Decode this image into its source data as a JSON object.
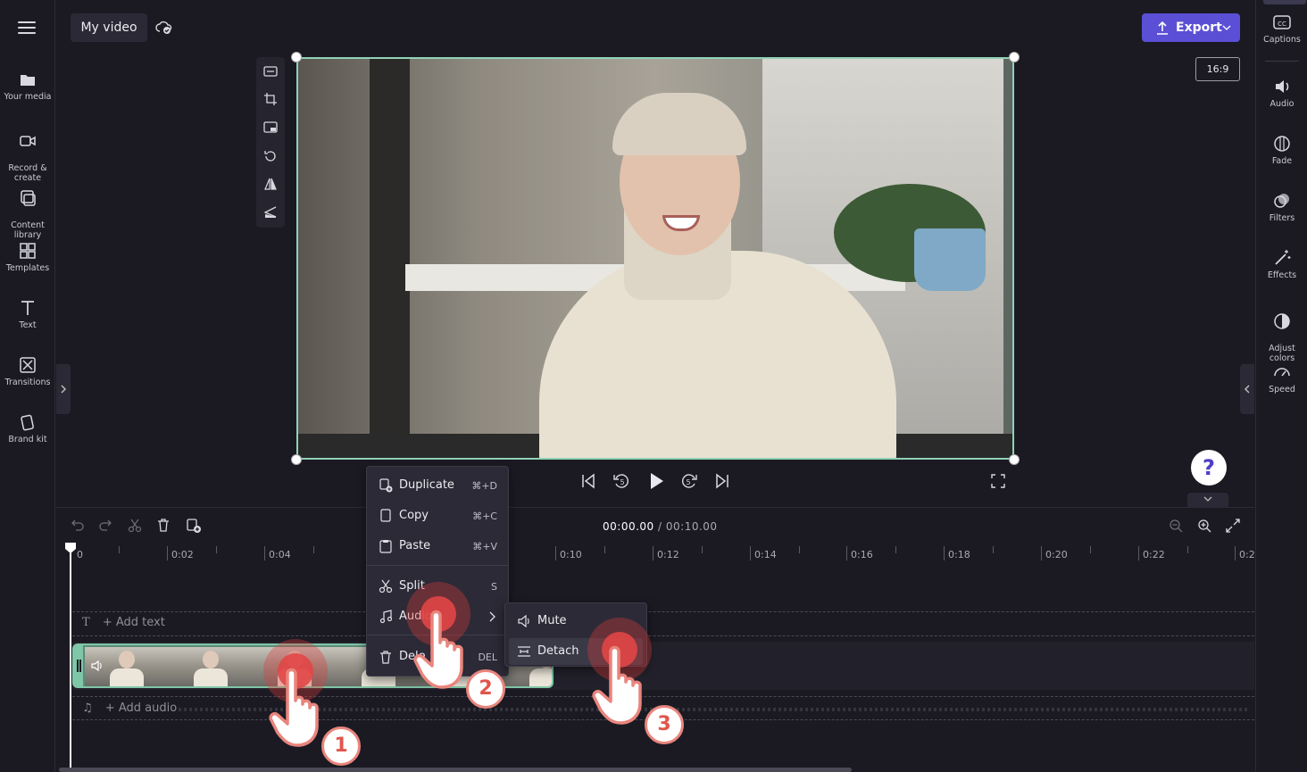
{
  "header": {
    "project_title": "My video",
    "export_label": "Export",
    "aspect_ratio": "16:9"
  },
  "left_nav": [
    {
      "label": "Your media",
      "icon": "folder-icon"
    },
    {
      "label": "Record &\ncreate",
      "icon": "camera-icon"
    },
    {
      "label": "Content\nlibrary",
      "icon": "library-icon"
    },
    {
      "label": "Templates",
      "icon": "templates-icon"
    },
    {
      "label": "Text",
      "icon": "text-icon"
    },
    {
      "label": "Transitions",
      "icon": "transitions-icon"
    },
    {
      "label": "Brand kit",
      "icon": "brand-kit-icon"
    }
  ],
  "right_nav": [
    {
      "label": "Captions",
      "icon": "captions-icon"
    },
    {
      "label": "Audio",
      "icon": "speaker-icon"
    },
    {
      "label": "Fade",
      "icon": "fade-icon"
    },
    {
      "label": "Filters",
      "icon": "filters-icon"
    },
    {
      "label": "Effects",
      "icon": "magic-wand-icon"
    },
    {
      "label": "Adjust\ncolors",
      "icon": "adjust-colors-icon"
    },
    {
      "label": "Speed",
      "icon": "speedometer-icon"
    }
  ],
  "timeline": {
    "current_time": "00:00.00",
    "separator": "/",
    "total_time": "00:10.00",
    "ruler": [
      "0",
      "0:02",
      "0:04",
      "0:10",
      "0:12",
      "0:14",
      "0:16",
      "0:18",
      "0:20",
      "0:22",
      "0:2"
    ],
    "add_text": "+ Add text",
    "add_audio": "+ Add audio"
  },
  "context_menu": {
    "items": [
      {
        "label": "Duplicate",
        "shortcut": "⌘+D"
      },
      {
        "label": "Copy",
        "shortcut": "⌘+C"
      },
      {
        "label": "Paste",
        "shortcut": "⌘+V"
      },
      {
        "label": "Split",
        "shortcut": "S"
      },
      {
        "label": "Audio",
        "shortcut": ""
      },
      {
        "label": "Dele",
        "shortcut": "DEL"
      }
    ],
    "submenu": [
      {
        "label": "Mute"
      },
      {
        "label": "Detach"
      }
    ]
  },
  "steps": [
    "1",
    "2",
    "3"
  ],
  "help_label": "?",
  "colors": {
    "accent": "#5b4fd6",
    "clip_border": "#7fc7a7",
    "video_border": "#8fd3b6",
    "cursor": "#e0564d"
  }
}
